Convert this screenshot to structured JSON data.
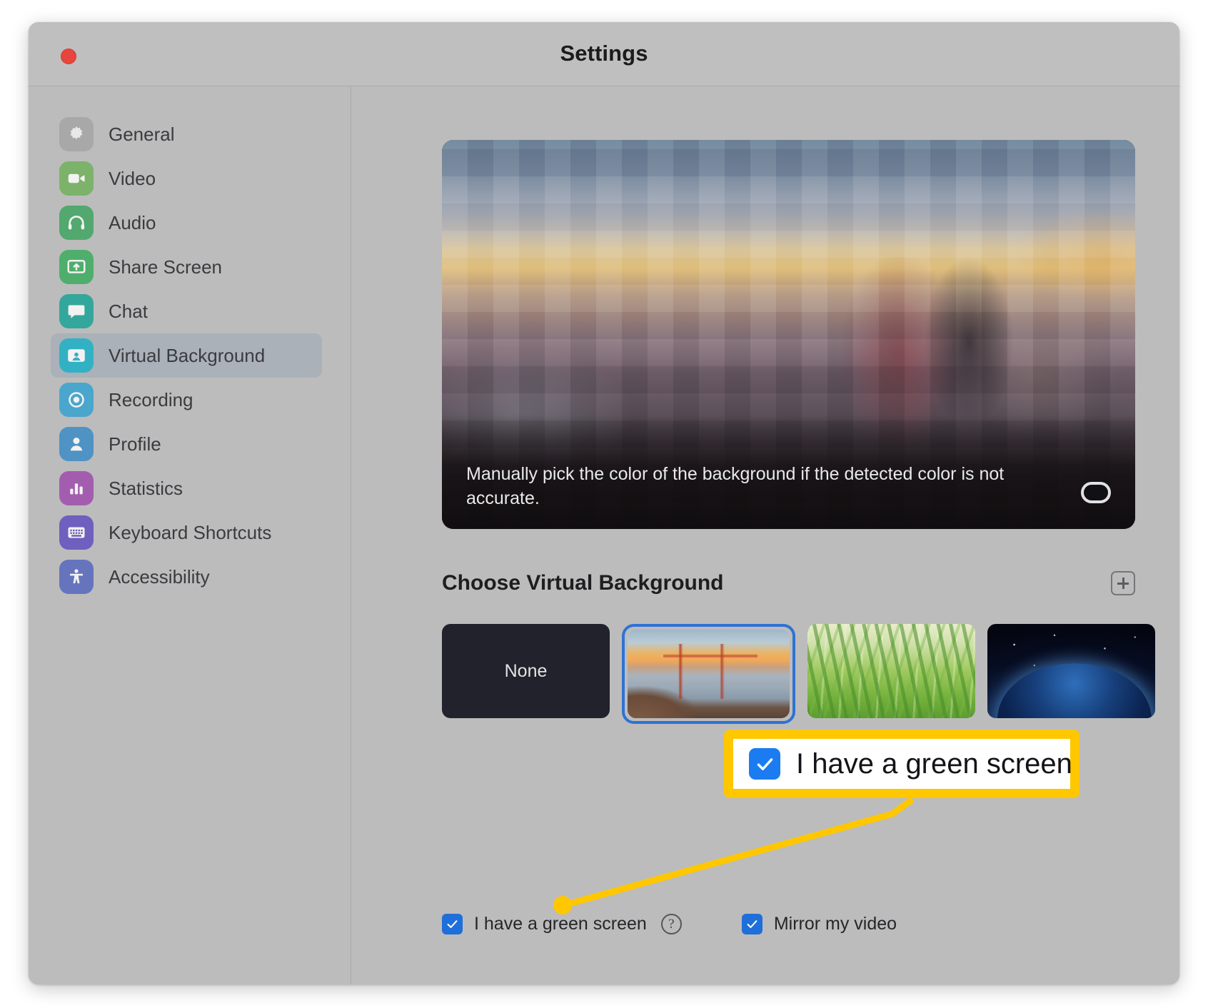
{
  "window": {
    "title": "Settings",
    "close_button": "close"
  },
  "sidebar": {
    "items": [
      {
        "label": "General",
        "icon": "gear-icon",
        "color": "#a8a8a8",
        "selected": false
      },
      {
        "label": "Video",
        "icon": "video-camera-icon",
        "color": "#7cb26a",
        "selected": false
      },
      {
        "label": "Audio",
        "icon": "headphones-icon",
        "color": "#52a86e",
        "selected": false
      },
      {
        "label": "Share Screen",
        "icon": "share-screen-icon",
        "color": "#4fae6c",
        "selected": false
      },
      {
        "label": "Chat",
        "icon": "chat-bubble-icon",
        "color": "#33a79b",
        "selected": false
      },
      {
        "label": "Virtual Background",
        "icon": "virtual-background-icon",
        "color": "#33b1c4",
        "selected": true
      },
      {
        "label": "Recording",
        "icon": "record-circle-icon",
        "color": "#4aa6cc",
        "selected": false
      },
      {
        "label": "Profile",
        "icon": "person-icon",
        "color": "#4f93c4",
        "selected": false
      },
      {
        "label": "Statistics",
        "icon": "bar-chart-icon",
        "color": "#a35dae",
        "selected": false
      },
      {
        "label": "Keyboard Shortcuts",
        "icon": "keyboard-icon",
        "color": "#6f5fbe",
        "selected": false
      },
      {
        "label": "Accessibility",
        "icon": "accessibility-icon",
        "color": "#6574bd",
        "selected": false
      }
    ]
  },
  "preview": {
    "caption": "Manually pick the color of the background if the detected color is not accurate.",
    "color_swatch_name": "color-picker-swatch"
  },
  "main": {
    "section_title": "Choose Virtual Background",
    "add_button": "+",
    "thumbnails": [
      {
        "label": "None",
        "kind": "none",
        "selected": false
      },
      {
        "label": "Golden Gate Bridge",
        "kind": "bridge",
        "selected": true
      },
      {
        "label": "Grass",
        "kind": "grass",
        "selected": false
      },
      {
        "label": "Earth from Space",
        "kind": "earth",
        "selected": false
      }
    ]
  },
  "options": {
    "green_screen_label": "I have a green screen",
    "green_screen_checked": true,
    "help_glyph": "?",
    "mirror_label": "Mirror my video",
    "mirror_checked": true
  },
  "annotation": {
    "callout_label": "I have a green screen",
    "callout_checked": true,
    "highlight_color": "#ffc700"
  }
}
